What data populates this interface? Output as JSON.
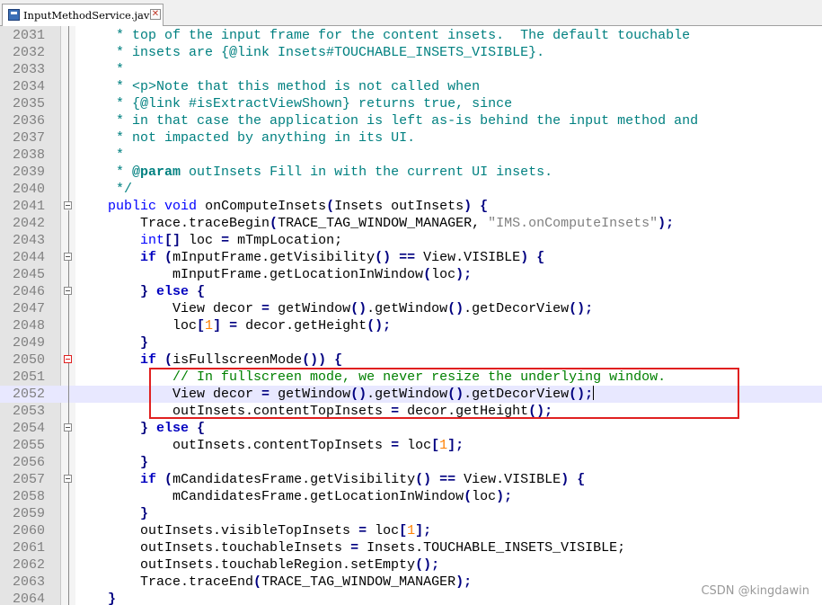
{
  "tab": {
    "title": "InputMethodService.java",
    "close_glyph": "✕"
  },
  "watermark": "CSDN @kingdawin",
  "colors": {
    "comment": "#008080",
    "keyword": "#0000ff",
    "string": "#808080",
    "number": "#ff8000",
    "line_comment": "#008000",
    "highlight_box": "#e02020",
    "current_line": "#e8e8ff"
  },
  "code": {
    "lines": [
      {
        "num": "2031",
        "parts": [
          [
            "",
            "     "
          ],
          [
            "c",
            "* top of the input frame for the content insets.  The default touchable"
          ]
        ]
      },
      {
        "num": "2032",
        "parts": [
          [
            "",
            "     "
          ],
          [
            "c",
            "* insets are {@link Insets#TOUCHABLE_INSETS_VISIBLE}."
          ]
        ]
      },
      {
        "num": "2033",
        "parts": [
          [
            "",
            "     "
          ],
          [
            "c",
            "*"
          ]
        ]
      },
      {
        "num": "2034",
        "parts": [
          [
            "",
            "     "
          ],
          [
            "c",
            "* <p>Note that this method is not called when"
          ]
        ]
      },
      {
        "num": "2035",
        "parts": [
          [
            "",
            "     "
          ],
          [
            "c",
            "* {@link #isExtractViewShown} returns true, since"
          ]
        ]
      },
      {
        "num": "2036",
        "parts": [
          [
            "",
            "     "
          ],
          [
            "c",
            "* in that case the application is left as-is behind the input method and"
          ]
        ]
      },
      {
        "num": "2037",
        "parts": [
          [
            "",
            "     "
          ],
          [
            "c",
            "* not impacted by anything in its UI."
          ]
        ]
      },
      {
        "num": "2038",
        "parts": [
          [
            "",
            "     "
          ],
          [
            "c",
            "*"
          ]
        ]
      },
      {
        "num": "2039",
        "parts": [
          [
            "",
            "     "
          ],
          [
            "c",
            "* "
          ],
          [
            "cb",
            "@param"
          ],
          [
            "c",
            " outInsets Fill in with the current UI insets."
          ]
        ]
      },
      {
        "num": "2040",
        "parts": [
          [
            "",
            "     "
          ],
          [
            "c",
            "*/"
          ]
        ]
      },
      {
        "num": "2041",
        "parts": [
          [
            "",
            "    "
          ],
          [
            "k",
            "public"
          ],
          [
            "",
            " "
          ],
          [
            "k",
            "void"
          ],
          [
            "",
            " onComputeInsets"
          ],
          [
            "p",
            "("
          ],
          [
            "",
            "Insets outInsets"
          ],
          [
            "p",
            ")"
          ],
          [
            "",
            " "
          ],
          [
            "p",
            "{"
          ]
        ]
      },
      {
        "num": "2042",
        "parts": [
          [
            "",
            "        Trace.traceBegin"
          ],
          [
            "p",
            "("
          ],
          [
            "",
            "TRACE_TAG_WINDOW_MANAGER, "
          ],
          [
            "s",
            "\"IMS.onComputeInsets\""
          ],
          [
            "p",
            ");"
          ]
        ]
      },
      {
        "num": "2043",
        "parts": [
          [
            "",
            "        "
          ],
          [
            "k",
            "int"
          ],
          [
            "p",
            "[]"
          ],
          [
            "",
            " loc "
          ],
          [
            "p",
            "="
          ],
          [
            "",
            " mTmpLocation;"
          ]
        ]
      },
      {
        "num": "2044",
        "parts": [
          [
            "",
            "        "
          ],
          [
            "kb",
            "if"
          ],
          [
            "",
            " "
          ],
          [
            "p",
            "("
          ],
          [
            "",
            "mInputFrame.getVisibility"
          ],
          [
            "p",
            "()"
          ],
          [
            "",
            " "
          ],
          [
            "p",
            "=="
          ],
          [
            "",
            " View.VISIBLE"
          ],
          [
            "p",
            ")"
          ],
          [
            "",
            " "
          ],
          [
            "p",
            "{"
          ]
        ]
      },
      {
        "num": "2045",
        "parts": [
          [
            "",
            "            mInputFrame.getLocationInWindow"
          ],
          [
            "p",
            "("
          ],
          [
            "",
            "loc"
          ],
          [
            "p",
            ");"
          ]
        ]
      },
      {
        "num": "2046",
        "parts": [
          [
            "",
            "        "
          ],
          [
            "p",
            "}"
          ],
          [
            "",
            " "
          ],
          [
            "kb",
            "else"
          ],
          [
            "",
            " "
          ],
          [
            "p",
            "{"
          ]
        ]
      },
      {
        "num": "2047",
        "parts": [
          [
            "",
            "            View decor "
          ],
          [
            "p",
            "="
          ],
          [
            "",
            " getWindow"
          ],
          [
            "p",
            "()"
          ],
          [
            "",
            ".getWindow"
          ],
          [
            "p",
            "()"
          ],
          [
            "",
            ".getDecorView"
          ],
          [
            "p",
            "();"
          ]
        ]
      },
      {
        "num": "2048",
        "parts": [
          [
            "",
            "            loc"
          ],
          [
            "p",
            "["
          ],
          [
            "n",
            "1"
          ],
          [
            "p",
            "]"
          ],
          [
            "",
            " "
          ],
          [
            "p",
            "="
          ],
          [
            "",
            " decor.getHeight"
          ],
          [
            "p",
            "();"
          ]
        ]
      },
      {
        "num": "2049",
        "parts": [
          [
            "",
            "        "
          ],
          [
            "p",
            "}"
          ]
        ]
      },
      {
        "num": "2050",
        "parts": [
          [
            "",
            "        "
          ],
          [
            "kb",
            "if"
          ],
          [
            "",
            " "
          ],
          [
            "p",
            "("
          ],
          [
            "",
            "isFullscreenMode"
          ],
          [
            "p",
            "())"
          ],
          [
            "",
            " "
          ],
          [
            "p",
            "{"
          ]
        ]
      },
      {
        "num": "2051",
        "parts": [
          [
            "",
            "            "
          ],
          [
            "cg",
            "// In fullscreen mode, we never resize the underlying window."
          ]
        ]
      },
      {
        "num": "2052",
        "parts": [
          [
            "",
            "            View decor "
          ],
          [
            "p",
            "="
          ],
          [
            "",
            " getWindow"
          ],
          [
            "p",
            "()"
          ],
          [
            "",
            ".getWindow"
          ],
          [
            "p",
            "()"
          ],
          [
            "",
            ".getDecorView"
          ],
          [
            "p",
            "();"
          ]
        ]
      },
      {
        "num": "2053",
        "parts": [
          [
            "",
            "            outInsets.contentTopInsets "
          ],
          [
            "p",
            "="
          ],
          [
            "",
            " decor.getHeight"
          ],
          [
            "p",
            "();"
          ]
        ]
      },
      {
        "num": "2054",
        "parts": [
          [
            "",
            "        "
          ],
          [
            "p",
            "}"
          ],
          [
            "",
            " "
          ],
          [
            "kb",
            "else"
          ],
          [
            "",
            " "
          ],
          [
            "p",
            "{"
          ]
        ]
      },
      {
        "num": "2055",
        "parts": [
          [
            "",
            "            outInsets.contentTopInsets "
          ],
          [
            "p",
            "="
          ],
          [
            "",
            " loc"
          ],
          [
            "p",
            "["
          ],
          [
            "n",
            "1"
          ],
          [
            "p",
            "];"
          ]
        ]
      },
      {
        "num": "2056",
        "parts": [
          [
            "",
            "        "
          ],
          [
            "p",
            "}"
          ]
        ]
      },
      {
        "num": "2057",
        "parts": [
          [
            "",
            "        "
          ],
          [
            "kb",
            "if"
          ],
          [
            "",
            " "
          ],
          [
            "p",
            "("
          ],
          [
            "",
            "mCandidatesFrame.getVisibility"
          ],
          [
            "p",
            "()"
          ],
          [
            "",
            " "
          ],
          [
            "p",
            "=="
          ],
          [
            "",
            " View.VISIBLE"
          ],
          [
            "p",
            ")"
          ],
          [
            "",
            " "
          ],
          [
            "p",
            "{"
          ]
        ]
      },
      {
        "num": "2058",
        "parts": [
          [
            "",
            "            mCandidatesFrame.getLocationInWindow"
          ],
          [
            "p",
            "("
          ],
          [
            "",
            "loc"
          ],
          [
            "p",
            ");"
          ]
        ]
      },
      {
        "num": "2059",
        "parts": [
          [
            "",
            "        "
          ],
          [
            "p",
            "}"
          ]
        ]
      },
      {
        "num": "2060",
        "parts": [
          [
            "",
            "        outInsets.visibleTopInsets "
          ],
          [
            "p",
            "="
          ],
          [
            "",
            " loc"
          ],
          [
            "p",
            "["
          ],
          [
            "n",
            "1"
          ],
          [
            "p",
            "];"
          ]
        ]
      },
      {
        "num": "2061",
        "parts": [
          [
            "",
            "        outInsets.touchableInsets "
          ],
          [
            "p",
            "="
          ],
          [
            "",
            " Insets.TOUCHABLE_INSETS_VISIBLE;"
          ]
        ]
      },
      {
        "num": "2062",
        "parts": [
          [
            "",
            "        outInsets.touchableRegion.setEmpty"
          ],
          [
            "p",
            "();"
          ]
        ]
      },
      {
        "num": "2063",
        "parts": [
          [
            "",
            "        Trace.traceEnd"
          ],
          [
            "p",
            "("
          ],
          [
            "",
            "TRACE_TAG_WINDOW_MANAGER"
          ],
          [
            "p",
            ");"
          ]
        ]
      },
      {
        "num": "2064",
        "parts": [
          [
            "",
            "    "
          ],
          [
            "p",
            "}"
          ]
        ]
      }
    ]
  }
}
